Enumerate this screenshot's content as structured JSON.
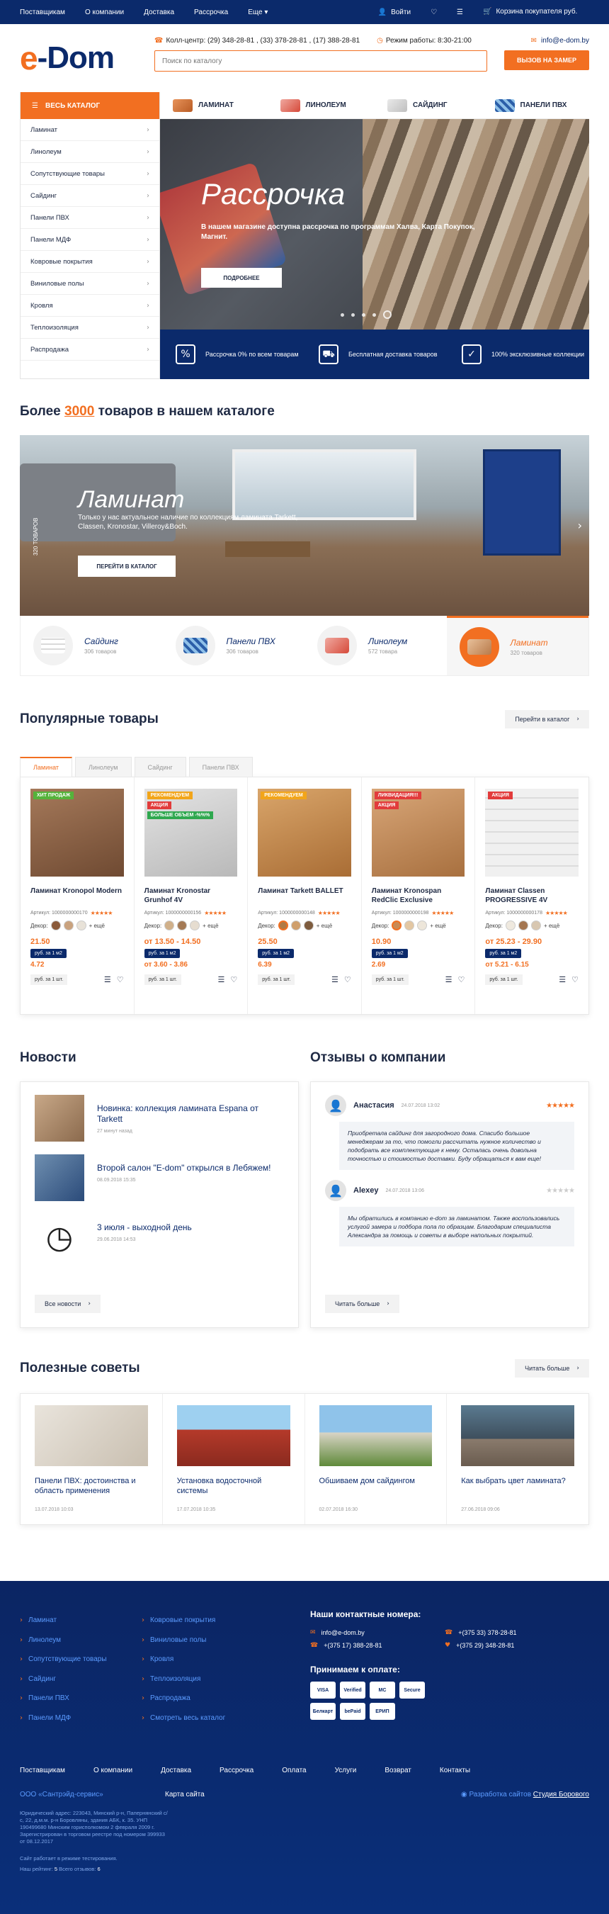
{
  "topbar": {
    "links": [
      "Поставщикам",
      "О компании",
      "Доставка",
      "Рассрочка",
      "Еще"
    ],
    "login": "Войти",
    "cart": "Корзина покупателя руб."
  },
  "header": {
    "logo_e": "e",
    "logo_text": "-Dom",
    "callcenter": "Колл-центр: (29) 348-28-81 , (33) 378-28-81 , (17) 388-28-81",
    "hours": "Режим работы: 8:30-21:00",
    "search_placeholder": "Поиск по каталогу",
    "email": "info@e-dom.by",
    "measure_btn": "ВЫЗОВ НА ЗАМЕР"
  },
  "sidebar": {
    "head": "ВЕСЬ КАТАЛОГ",
    "items": [
      "Ламинат",
      "Линолеум",
      "Сопутствующие товары",
      "Сайдинг",
      "Панели ПВХ",
      "Панели МДФ",
      "Ковровые покрытия",
      "Виниловые полы",
      "Кровля",
      "Теплоизоляция",
      "Распродажа"
    ]
  },
  "cat_tabs": [
    "ЛАМИНАТ",
    "ЛИНОЛЕУМ",
    "САЙДИНГ",
    "ПАНЕЛИ ПВХ"
  ],
  "hero": {
    "title": "Рассрочка",
    "text": "В нашем магазине доступна рассрочка по программам Халва, Карта Покупок, Магнит.",
    "button": "ПОДРОБНЕЕ"
  },
  "features": [
    "Рассрочка 0% по всем товарам",
    "Бесплатная доставка товаров",
    "100% эксклюзивные коллекции"
  ],
  "catalog_section": {
    "prefix": "Более ",
    "count": "3000",
    "suffix": " товаров в нашем каталоге"
  },
  "banner2": {
    "title": "Ламинат",
    "text": "Только у нас актуальное наличие по коллекциям ламината Tarkett, Classen, Kronostar, Villeroy&Boch.",
    "button": "ПЕРЕЙТИ В КАТАЛОГ",
    "vertical": "320 ТОВАРОВ"
  },
  "cat_cards": [
    {
      "name": "Сайдинг",
      "count": "306 товаров"
    },
    {
      "name": "Панели ПВХ",
      "count": "306 товаров"
    },
    {
      "name": "Линолеум",
      "count": "572 товара"
    },
    {
      "name": "Ламинат",
      "count": "320 товаров"
    }
  ],
  "popular": {
    "title": "Популярные товары",
    "to_catalog": "Перейти в каталог",
    "tabs": [
      "Ламинат",
      "Линолеум",
      "Сайдинг",
      "Панели ПВХ"
    ]
  },
  "products": [
    {
      "badges": [
        "ХИТ ПРОДАЖ"
      ],
      "name": "Ламинат Kronopol Modern",
      "article": "Артикул: 1000000000170",
      "decor": "Декор:",
      "more": "+ ещё",
      "price": "21.50",
      "unit": "руб. за 1 м2",
      "old": "4.72",
      "unit2": "руб. за 1 шт."
    },
    {
      "badges": [
        "РЕКОМЕНДУЕМ",
        "АКЦИЯ",
        "БОЛЬШЕ ОБЪЕМ -%%%"
      ],
      "name": "Ламинат Kronostar Grunhof 4V",
      "article": "Артикул: 1000000000156",
      "decor": "Декор:",
      "more": "+ ещё",
      "price": "от 13.50 - 14.50",
      "unit": "руб. за 1 м2",
      "old": "от 3.60 - 3.86",
      "unit2": "руб. за 1 шт."
    },
    {
      "badges": [
        "РЕКОМЕНДУЕМ"
      ],
      "name": "Ламинат Tarkett BALLET",
      "article": "Артикул: 1000000000148",
      "decor": "Декор:",
      "more": "+ ещё",
      "price": "25.50",
      "unit": "руб. за 1 м2",
      "old": "6.39",
      "unit2": "руб. за 1 шт."
    },
    {
      "badges": [
        "ЛИКВИДАЦИЯ!!!",
        "АКЦИЯ"
      ],
      "name": "Ламинат Kronospan RedClic Exclusive",
      "article": "Артикул: 1000000000198",
      "decor": "Декор:",
      "more": "+ ещё",
      "price": "10.90",
      "unit": "руб. за 1 м2",
      "old": "2.69",
      "unit2": "руб. за 1 шт."
    },
    {
      "badges": [
        "АКЦИЯ"
      ],
      "name": "Ламинат Classen PROGRESSIVE 4V",
      "article": "Артикул: 1000000000178",
      "decor": "Декор:",
      "more": "+ ещё",
      "price": "от 25.23 - 29.90",
      "unit": "руб. за 1 м2",
      "old": "от 5.21 - 6.15",
      "unit2": "руб. за 1 шт."
    }
  ],
  "news": {
    "title": "Новости",
    "items": [
      {
        "title": "Новинка: коллекция ламината Espana от Tarkett",
        "date": "27 минут назад"
      },
      {
        "title": "Второй салон \"E-dom\" открылся в Лебяжем!",
        "date": "08.09.2018 15:35"
      },
      {
        "title": "3 июля - выходной день",
        "date": "29.06.2018 14:53"
      }
    ],
    "all": "Все новости"
  },
  "reviews": {
    "title": "Отзывы о компании",
    "items": [
      {
        "name": "Анастасия",
        "date": "24.07.2018 13:02",
        "text": "Приобретала сайдинг для загородного дома. Спасибо большое менеджерам за то, что помогли рассчитать нужное количество и подобрать все комплектующие к нему. Осталась очень довольна точностью и стоимостью доставки. Буду обращаться к вам еще!"
      },
      {
        "name": "Alexey",
        "date": "24.07.2018 13:06",
        "text": "Мы обратились в компанию e-dom за ламинатом. Также воспользовались услугой замера и подбора пола по образцам. Благодарим специалиста Александра за помощь и советы в выборе напольных покрытий."
      }
    ],
    "more": "Читать больше"
  },
  "tips": {
    "title": "Полезные советы",
    "more": "Читать больше",
    "items": [
      {
        "title": "Панели ПВХ: достоинства и область применения",
        "date": "13.07.2018 10:03"
      },
      {
        "title": "Установка водосточной системы",
        "date": "17.07.2018 10:35"
      },
      {
        "title": "Обшиваем дом сайдингом",
        "date": "02.07.2018 16:30"
      },
      {
        "title": "Как выбрать цвет ламината?",
        "date": "27.06.2018 09:06"
      }
    ]
  },
  "footer": {
    "col1": [
      "Ламинат",
      "Линолеум",
      "Сопутствующие товары",
      "Сайдинг",
      "Панели ПВХ",
      "Панели МДФ"
    ],
    "col2": [
      "Ковровые покрытия",
      "Виниловые полы",
      "Кровля",
      "Теплоизоляция",
      "Распродажа",
      "Смотреть весь каталог"
    ],
    "contacts_title": "Наши контактные номера:",
    "email": "info@e-dom.by",
    "phone1": "+(375 33) 378-28-81",
    "phone2": "+(375 17) 388-28-81",
    "phone3": "+(375 29) 348-28-81",
    "pay_title": "Принимаем к оплате:",
    "pay": [
      "VISA",
      "Verified",
      "MC",
      "Secure",
      "Белкарт",
      "bePaid",
      "ЕРИП"
    ],
    "menu": [
      "Поставщикам",
      "О компании",
      "Доставка",
      "Рассрочка",
      "Оплата",
      "Услуги",
      "Возврат",
      "Контакты"
    ],
    "company": "ООО «Сантрэйд-сервис»",
    "map": "Карта сайта",
    "dev_prefix": "Разработка сайтов ",
    "dev_name": "Студия Борового",
    "legal": "Юридический адрес: 223043, Минский р-н, Папернянский с/с, 22, д.м.м. р-н Боровляны, здания АБК, к. 35. УНП 190499680 Минским горисполкомом 2 февраля 2009 г. Зарегистрирован в торговом реестре под номером 399933 от 08.12.2017",
    "note": "Сайт работает в режиме тестирования.",
    "rating_prefix": "Наш рейтинг:",
    "rating": "5",
    "reviews_prefix": "Всего отзывов:",
    "reviews_count": "6"
  }
}
